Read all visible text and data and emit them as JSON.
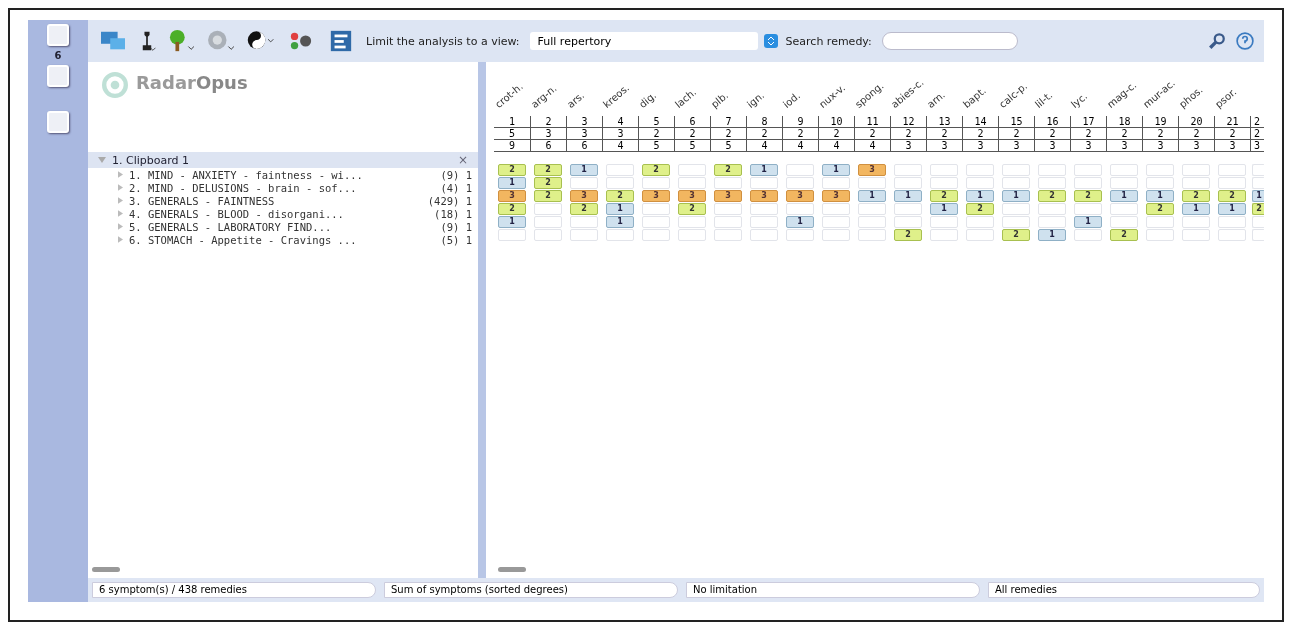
{
  "sidebar": {
    "count": "6"
  },
  "toolbar": {
    "view_label": "Limit the analysis to a view:",
    "view_value": "Full repertory",
    "search_label": "Search remedy:"
  },
  "logo": {
    "part_1": "Radar",
    "part_2": "Opus"
  },
  "clipboard": {
    "title": "1. Clipboard 1",
    "expanded": true,
    "close": "×",
    "symptoms": [
      {
        "label": "1. MIND - ANXIETY - faintness - wi...",
        "count": "(9) 1"
      },
      {
        "label": "2. MIND - DELUSIONS - brain - sof...",
        "count": "(4) 1"
      },
      {
        "label": "3. GENERALS - FAINTNESS",
        "count": "(429) 1"
      },
      {
        "label": "4. GENERALS - BLOOD - disorgani...",
        "count": "(18) 1"
      },
      {
        "label": "5. GENERALS - LABORATORY FIND...",
        "count": "(9) 1"
      },
      {
        "label": "6. STOMACH - Appetite - Cravings ...",
        "count": "(5) 1"
      }
    ]
  },
  "remedies": [
    {
      "name": "crot-h.",
      "rank": "1",
      "score": "5",
      "total": "9"
    },
    {
      "name": "arg-n.",
      "rank": "2",
      "score": "3",
      "total": "6"
    },
    {
      "name": "ars.",
      "rank": "3",
      "score": "3",
      "total": "6"
    },
    {
      "name": "kreos.",
      "rank": "4",
      "score": "3",
      "total": "4"
    },
    {
      "name": "dig.",
      "rank": "5",
      "score": "2",
      "total": "5"
    },
    {
      "name": "lach.",
      "rank": "6",
      "score": "2",
      "total": "5"
    },
    {
      "name": "plb.",
      "rank": "7",
      "score": "2",
      "total": "5"
    },
    {
      "name": "ign.",
      "rank": "8",
      "score": "2",
      "total": "4"
    },
    {
      "name": "iod.",
      "rank": "9",
      "score": "2",
      "total": "4"
    },
    {
      "name": "nux-v.",
      "rank": "10",
      "score": "2",
      "total": "4"
    },
    {
      "name": "spong.",
      "rank": "11",
      "score": "2",
      "total": "4"
    },
    {
      "name": "abies-c.",
      "rank": "12",
      "score": "2",
      "total": "3"
    },
    {
      "name": "arn.",
      "rank": "13",
      "score": "2",
      "total": "3"
    },
    {
      "name": "bapt.",
      "rank": "14",
      "score": "2",
      "total": "3"
    },
    {
      "name": "calc-p.",
      "rank": "15",
      "score": "2",
      "total": "3"
    },
    {
      "name": "lil-t.",
      "rank": "16",
      "score": "2",
      "total": "3"
    },
    {
      "name": "lyc.",
      "rank": "17",
      "score": "2",
      "total": "3"
    },
    {
      "name": "mag-c.",
      "rank": "18",
      "score": "2",
      "total": "3"
    },
    {
      "name": "mur-ac.",
      "rank": "19",
      "score": "2",
      "total": "3"
    },
    {
      "name": "phos.",
      "rank": "20",
      "score": "2",
      "total": "3"
    },
    {
      "name": "psor.",
      "rank": "21",
      "score": "2",
      "total": "3"
    },
    {
      "rank": "2",
      "score": "2",
      "total": "3"
    }
  ],
  "grid": [
    [
      {
        "kind": "degree",
        "degree": "2"
      },
      {
        "kind": "degree",
        "degree": "2"
      },
      {
        "kind": "degree",
        "degree": "1"
      },
      {
        "kind": "empty"
      },
      {
        "kind": "degree",
        "degree": "2"
      },
      {
        "kind": "empty"
      },
      {
        "kind": "degree",
        "degree": "2"
      },
      {
        "kind": "degree",
        "degree": "1"
      },
      {
        "kind": "empty"
      },
      {
        "kind": "degree",
        "degree": "1"
      },
      {
        "kind": "degree",
        "degree": "3"
      },
      {
        "kind": "empty"
      },
      {
        "kind": "empty"
      },
      {
        "kind": "empty"
      },
      {
        "kind": "empty"
      },
      {
        "kind": "empty"
      },
      {
        "kind": "empty"
      },
      {
        "kind": "empty"
      },
      {
        "kind": "empty"
      },
      {
        "kind": "empty"
      },
      {
        "kind": "empty"
      },
      {
        "kind": "empty"
      }
    ],
    [
      {
        "kind": "degree",
        "degree": "1"
      },
      {
        "kind": "degree",
        "degree": "2"
      },
      {
        "kind": "empty"
      },
      {
        "kind": "empty"
      },
      {
        "kind": "empty"
      },
      {
        "kind": "empty"
      },
      {
        "kind": "empty"
      },
      {
        "kind": "empty"
      },
      {
        "kind": "empty"
      },
      {
        "kind": "empty"
      },
      {
        "kind": "empty"
      },
      {
        "kind": "empty"
      },
      {
        "kind": "empty"
      },
      {
        "kind": "empty"
      },
      {
        "kind": "empty"
      },
      {
        "kind": "empty"
      },
      {
        "kind": "empty"
      },
      {
        "kind": "empty"
      },
      {
        "kind": "empty"
      },
      {
        "kind": "empty"
      },
      {
        "kind": "empty"
      },
      {
        "kind": "empty"
      }
    ],
    [
      {
        "kind": "degree",
        "degree": "3"
      },
      {
        "kind": "degree",
        "degree": "2"
      },
      {
        "kind": "degree",
        "degree": "3"
      },
      {
        "kind": "degree",
        "degree": "2"
      },
      {
        "kind": "degree",
        "degree": "3"
      },
      {
        "kind": "degree",
        "degree": "3"
      },
      {
        "kind": "degree",
        "degree": "3"
      },
      {
        "kind": "degree",
        "degree": "3"
      },
      {
        "kind": "degree",
        "degree": "3"
      },
      {
        "kind": "degree",
        "degree": "3"
      },
      {
        "kind": "degree",
        "degree": "1"
      },
      {
        "kind": "degree",
        "degree": "1"
      },
      {
        "kind": "degree",
        "degree": "2"
      },
      {
        "kind": "degree",
        "degree": "1"
      },
      {
        "kind": "degree",
        "degree": "1"
      },
      {
        "kind": "degree",
        "degree": "2"
      },
      {
        "kind": "degree",
        "degree": "2"
      },
      {
        "kind": "degree",
        "degree": "1"
      },
      {
        "kind": "degree",
        "degree": "1"
      },
      {
        "kind": "degree",
        "degree": "2"
      },
      {
        "kind": "degree",
        "degree": "2"
      },
      {
        "kind": "degree",
        "degree": "1"
      }
    ],
    [
      {
        "kind": "degree",
        "degree": "2"
      },
      {
        "kind": "empty"
      },
      {
        "kind": "degree",
        "degree": "2"
      },
      {
        "kind": "degree",
        "degree": "1"
      },
      {
        "kind": "empty"
      },
      {
        "kind": "degree",
        "degree": "2"
      },
      {
        "kind": "empty"
      },
      {
        "kind": "empty"
      },
      {
        "kind": "empty"
      },
      {
        "kind": "empty"
      },
      {
        "kind": "empty"
      },
      {
        "kind": "empty"
      },
      {
        "kind": "degree",
        "degree": "1"
      },
      {
        "kind": "degree",
        "degree": "2"
      },
      {
        "kind": "empty"
      },
      {
        "kind": "empty"
      },
      {
        "kind": "empty"
      },
      {
        "kind": "empty"
      },
      {
        "kind": "degree",
        "degree": "2"
      },
      {
        "kind": "degree",
        "degree": "1"
      },
      {
        "kind": "degree",
        "degree": "1"
      },
      {
        "kind": "degree",
        "degree": "2"
      }
    ],
    [
      {
        "kind": "degree",
        "degree": "1"
      },
      {
        "kind": "empty"
      },
      {
        "kind": "empty"
      },
      {
        "kind": "degree",
        "degree": "1"
      },
      {
        "kind": "empty"
      },
      {
        "kind": "empty"
      },
      {
        "kind": "empty"
      },
      {
        "kind": "empty"
      },
      {
        "kind": "degree",
        "degree": "1"
      },
      {
        "kind": "empty"
      },
      {
        "kind": "empty"
      },
      {
        "kind": "empty"
      },
      {
        "kind": "empty"
      },
      {
        "kind": "empty"
      },
      {
        "kind": "empty"
      },
      {
        "kind": "empty"
      },
      {
        "kind": "degree",
        "degree": "1"
      },
      {
        "kind": "empty"
      },
      {
        "kind": "empty"
      },
      {
        "kind": "empty"
      },
      {
        "kind": "empty"
      },
      {
        "kind": "empty"
      }
    ],
    [
      {
        "kind": "empty"
      },
      {
        "kind": "empty"
      },
      {
        "kind": "empty"
      },
      {
        "kind": "empty"
      },
      {
        "kind": "empty"
      },
      {
        "kind": "empty"
      },
      {
        "kind": "empty"
      },
      {
        "kind": "empty"
      },
      {
        "kind": "empty"
      },
      {
        "kind": "empty"
      },
      {
        "kind": "empty"
      },
      {
        "kind": "degree",
        "degree": "2"
      },
      {
        "kind": "empty"
      },
      {
        "kind": "empty"
      },
      {
        "kind": "degree",
        "degree": "2"
      },
      {
        "kind": "degree",
        "degree": "1"
      },
      {
        "kind": "empty"
      },
      {
        "kind": "degree",
        "degree": "2"
      },
      {
        "kind": "empty"
      },
      {
        "kind": "empty"
      },
      {
        "kind": "empty"
      },
      {
        "kind": "empty"
      }
    ]
  ],
  "status_bar": [
    "6 symptom(s) / 438 remedies",
    "Sum of symptoms (sorted degrees)",
    "No limitation",
    "All remedies"
  ]
}
